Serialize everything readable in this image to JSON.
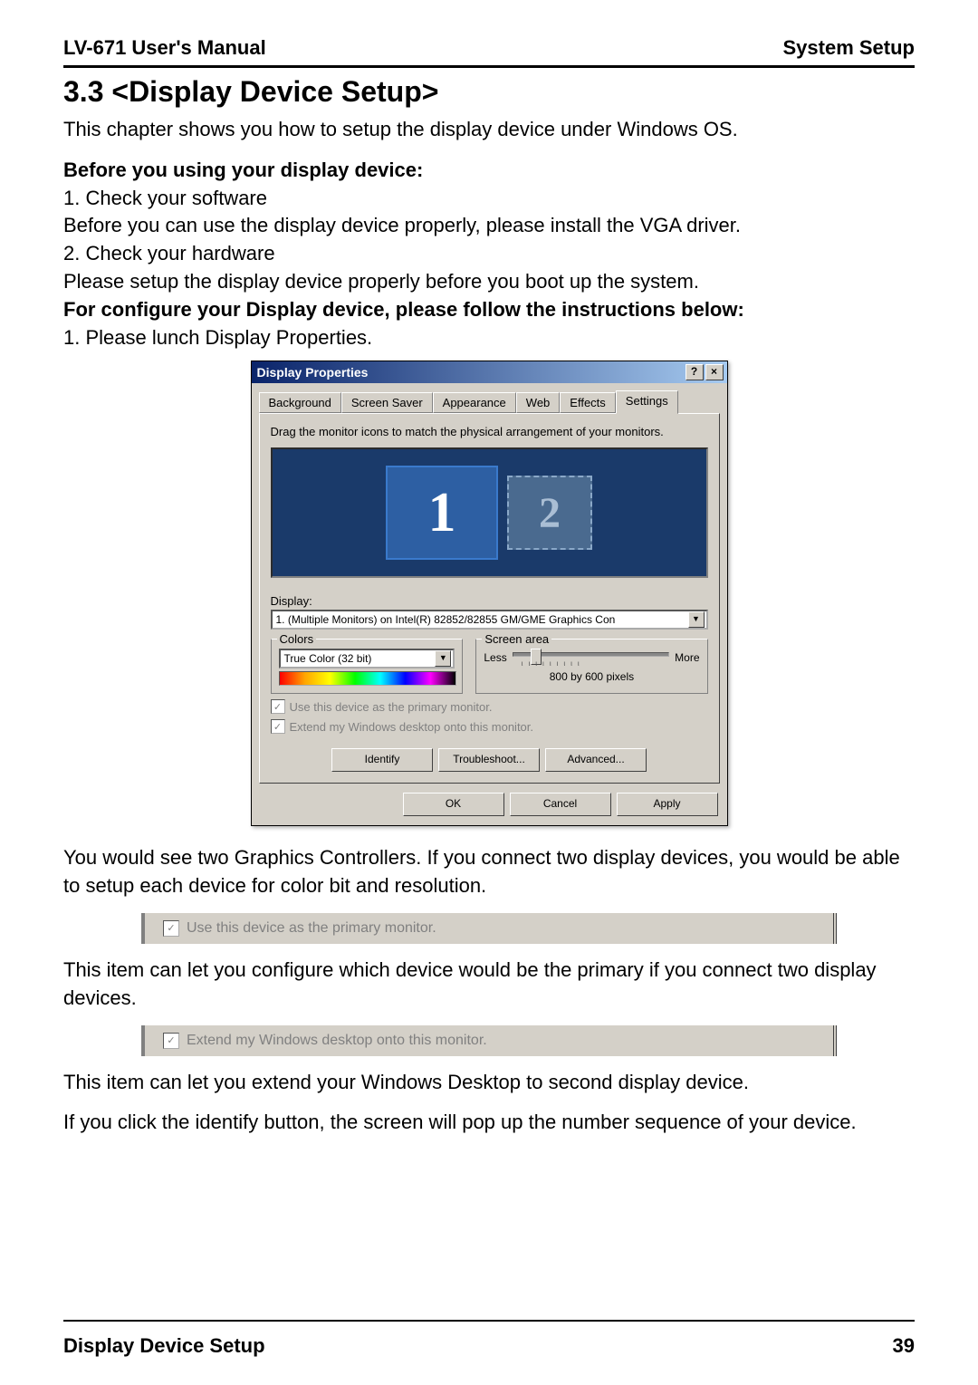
{
  "header": {
    "left": "LV-671 User's Manual",
    "right": "System Setup"
  },
  "section_title": "3.3 <Display Device Setup>",
  "intro": "This chapter shows you how to setup the display device under Windows OS.",
  "before_heading": "Before you using your display device:",
  "step1": "1. Check your software",
  "step1_desc": "Before you can use the display device properly, please install the VGA driver.",
  "step2": "2. Check your hardware",
  "step2_desc": "Please setup the display device properly before you boot up the system.",
  "config_heading": "For configure your Display device, please follow the instructions below:",
  "config_step1": "1. Please lunch Display Properties.",
  "dialog": {
    "title": "Display Properties",
    "help_btn": "?",
    "close_btn": "×",
    "tabs": [
      "Background",
      "Screen Saver",
      "Appearance",
      "Web",
      "Effects",
      "Settings"
    ],
    "instruction": "Drag the monitor icons to match the physical arrangement of your monitors.",
    "monitor1": "1",
    "monitor2": "2",
    "display_label": "Display:",
    "display_value": "1. (Multiple Monitors) on Intel(R) 82852/82855 GM/GME Graphics Con",
    "colors_label": "Colors",
    "colors_value": "True Color (32 bit)",
    "screen_area_label": "Screen area",
    "less": "Less",
    "more": "More",
    "resolution": "800 by 600 pixels",
    "chk_primary": "Use this device as the primary monitor.",
    "chk_extend": "Extend my Windows desktop onto this monitor.",
    "btn_identify": "Identify",
    "btn_troubleshoot": "Troubleshoot...",
    "btn_advanced": "Advanced...",
    "btn_ok": "OK",
    "btn_cancel": "Cancel",
    "btn_apply": "Apply"
  },
  "para_after_dialog": "You would see two Graphics Controllers. If you connect two display devices, you would be able to setup each device for color bit and resolution.",
  "snippet1": "Use this device as the primary monitor.",
  "para_snippet1": "This item can let you configure which device would be the primary if you connect two display devices.",
  "snippet2": "Extend my Windows desktop onto this monitor.",
  "para_snippet2": "This item can let you extend your Windows Desktop to second display device.",
  "para_identify": "If you click the identify button, the screen will pop up the number sequence of your device.",
  "footer": {
    "left": "Display Device Setup",
    "right": "39"
  }
}
